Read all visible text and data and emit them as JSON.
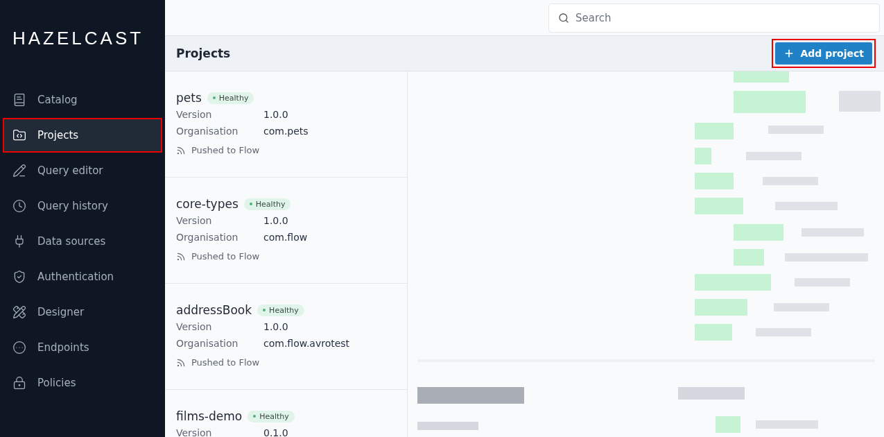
{
  "sidebar": {
    "logo": "HAZELCAST",
    "items": [
      {
        "label": "Catalog",
        "selected": false,
        "highlighted": false
      },
      {
        "label": "Projects",
        "selected": true,
        "highlighted": true
      },
      {
        "label": "Query editor",
        "selected": false,
        "highlighted": false
      },
      {
        "label": "Query history",
        "selected": false,
        "highlighted": false
      },
      {
        "label": "Data sources",
        "selected": false,
        "highlighted": false
      },
      {
        "label": "Authentication",
        "selected": false,
        "highlighted": false
      },
      {
        "label": "Designer",
        "selected": false,
        "highlighted": false
      },
      {
        "label": "Endpoints",
        "selected": false,
        "highlighted": false
      },
      {
        "label": "Policies",
        "selected": false,
        "highlighted": false
      }
    ]
  },
  "search": {
    "placeholder": "Search"
  },
  "header": {
    "title": "Projects",
    "add_button": {
      "label": "Add project",
      "highlighted": true
    }
  },
  "projects": [
    {
      "name": "pets",
      "status": "Healthy",
      "version_label": "Version",
      "version": "1.0.0",
      "org_label": "Organisation",
      "org": "com.pets",
      "pushed": "Pushed to Flow"
    },
    {
      "name": "core-types",
      "status": "Healthy",
      "version_label": "Version",
      "version": "1.0.0",
      "org_label": "Organisation",
      "org": "com.flow",
      "pushed": "Pushed to Flow"
    },
    {
      "name": "addressBook",
      "status": "Healthy",
      "version_label": "Version",
      "version": "1.0.0",
      "org_label": "Organisation",
      "org": "com.flow.avrotest",
      "pushed": "Pushed to Flow"
    },
    {
      "name": "films-demo",
      "status": "Healthy",
      "version_label": "Version",
      "version": "0.1.0"
    }
  ]
}
